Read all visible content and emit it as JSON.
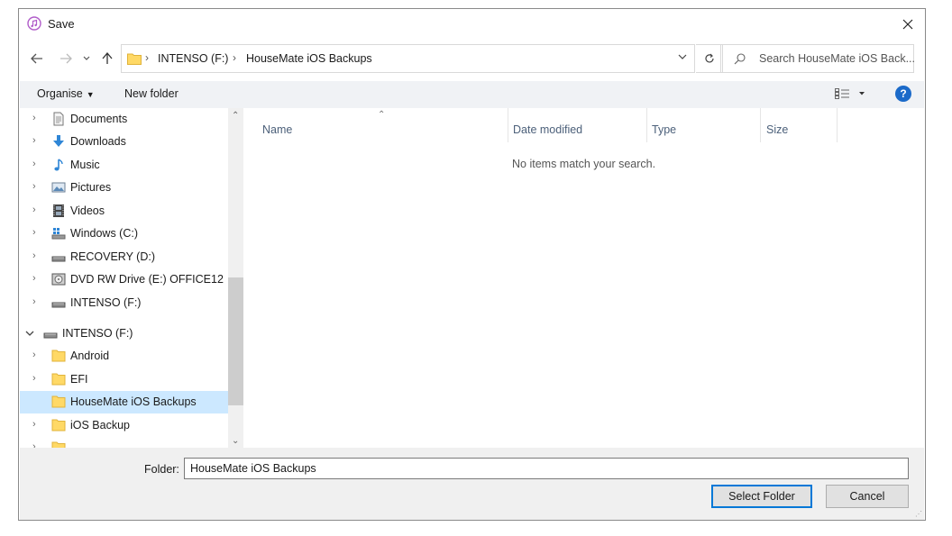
{
  "window": {
    "title": "Save",
    "icon": "itunes-icon"
  },
  "address_bar": {
    "crumbs": [
      "INTENSO (F:)",
      "HouseMate iOS Backups"
    ]
  },
  "search": {
    "placeholder": "Search HouseMate iOS Back..."
  },
  "toolbar": {
    "organise_label": "Organise",
    "new_folder_label": "New folder"
  },
  "nav_tree": {
    "items": [
      {
        "label": "Documents",
        "icon": "documents-icon"
      },
      {
        "label": "Downloads",
        "icon": "downloads-icon"
      },
      {
        "label": "Music",
        "icon": "music-icon"
      },
      {
        "label": "Pictures",
        "icon": "pictures-icon"
      },
      {
        "label": "Videos",
        "icon": "videos-icon"
      },
      {
        "label": "Windows (C:)",
        "icon": "windows-drive-icon"
      },
      {
        "label": "RECOVERY (D:)",
        "icon": "drive-icon"
      },
      {
        "label": "DVD RW Drive (E:) OFFICE12",
        "icon": "dvd-drive-icon"
      },
      {
        "label": "INTENSO (F:)",
        "icon": "drive-icon"
      },
      {
        "label": "INTENSO (F:)",
        "icon": "drive-icon"
      },
      {
        "label": "Android",
        "icon": "folder-icon"
      },
      {
        "label": "EFI",
        "icon": "folder-icon"
      },
      {
        "label": "HouseMate iOS Backups",
        "icon": "folder-icon",
        "selected": true
      },
      {
        "label": "iOS Backup",
        "icon": "folder-icon"
      }
    ]
  },
  "columns": {
    "name": "Name",
    "date_modified": "Date modified",
    "type": "Type",
    "size": "Size"
  },
  "content": {
    "empty_message": "No items match your search."
  },
  "footer": {
    "folder_label": "Folder:",
    "folder_value": "HouseMate iOS Backups",
    "select_label": "Select Folder",
    "cancel_label": "Cancel"
  },
  "colors": {
    "accent": "#0078d7",
    "selection": "#cce8ff",
    "folder": "#ffd966",
    "help": "#1b6ac9"
  }
}
